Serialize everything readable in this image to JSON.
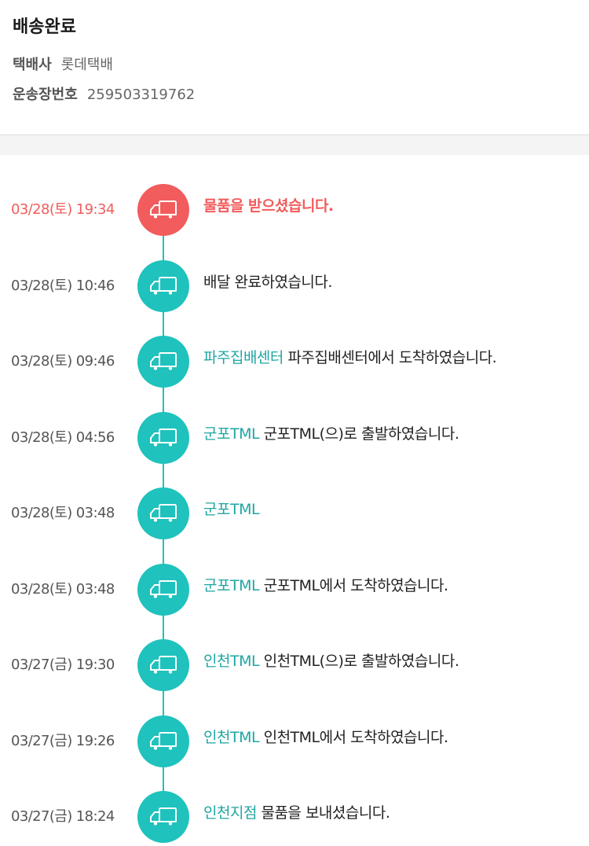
{
  "header": {
    "status_title": "배송완료",
    "courier_label": "택배사",
    "courier_value": "롯데택배",
    "tracking_label": "운송장번호",
    "tracking_value": "259503319762"
  },
  "colors": {
    "accent_teal": "#1fc2bd",
    "location_teal": "#1fa6a2",
    "current_red": "#f25c5c"
  },
  "timeline": {
    "icon": "delivery-truck-icon",
    "events": [
      {
        "time": "03/28(토) 19:34",
        "location": "",
        "message": "물품을 받으셨습니다.",
        "current": true
      },
      {
        "time": "03/28(토) 10:46",
        "location": "",
        "message": "배달 완료하였습니다.",
        "current": false
      },
      {
        "time": "03/28(토) 09:46",
        "location": "파주집배센터",
        "message": "파주집배센터에서 도착하였습니다.",
        "current": false
      },
      {
        "time": "03/28(토) 04:56",
        "location": "군포TML",
        "message": "군포TML(으)로 출발하였습니다.",
        "current": false
      },
      {
        "time": "03/28(토) 03:48",
        "location": "군포TML",
        "message": "",
        "current": false
      },
      {
        "time": "03/28(토) 03:48",
        "location": "군포TML",
        "message": "군포TML에서 도착하였습니다.",
        "current": false
      },
      {
        "time": "03/27(금) 19:30",
        "location": "인천TML",
        "message": "인천TML(으)로 출발하였습니다.",
        "current": false
      },
      {
        "time": "03/27(금) 19:26",
        "location": "인천TML",
        "message": "인천TML에서 도착하였습니다.",
        "current": false
      },
      {
        "time": "03/27(금) 18:24",
        "location": "인천지점",
        "message": "물품을 보내셨습니다.",
        "current": false
      }
    ]
  }
}
